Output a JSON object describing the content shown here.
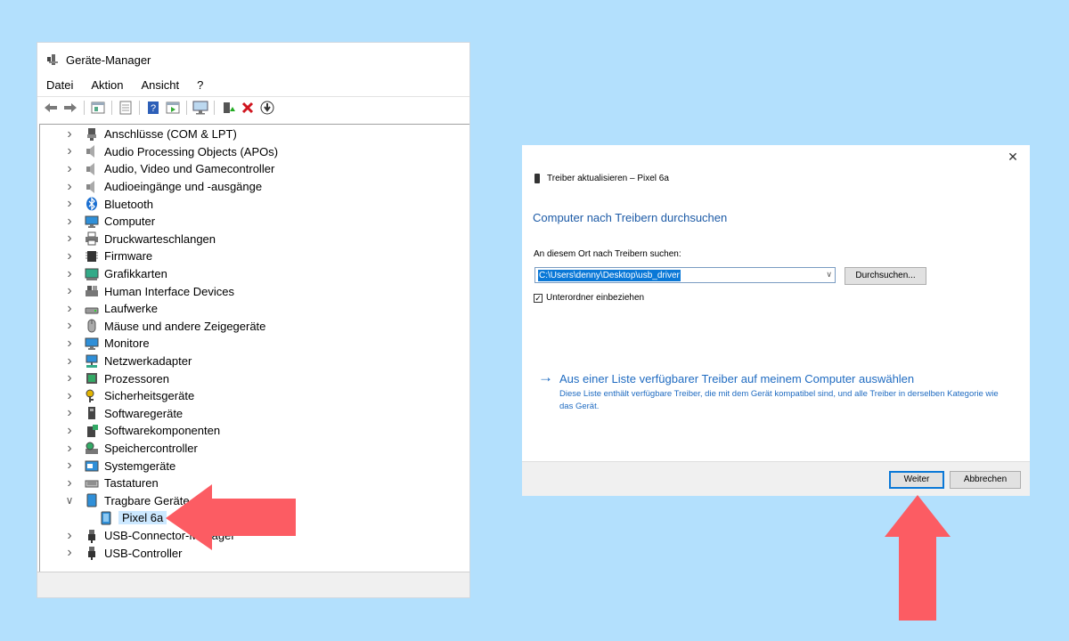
{
  "device_manager": {
    "title": "Geräte-Manager",
    "menu": [
      "Datei",
      "Aktion",
      "Ansicht",
      "?"
    ],
    "tree": [
      {
        "label": "Anschlüsse (COM & LPT)",
        "icon": "port-icon",
        "expanded": false
      },
      {
        "label": "Audio Processing Objects (APOs)",
        "icon": "speaker-icon",
        "expanded": false
      },
      {
        "label": "Audio, Video und Gamecontroller",
        "icon": "speaker-icon",
        "expanded": false
      },
      {
        "label": "Audioeingänge und -ausgänge",
        "icon": "speaker-icon",
        "expanded": false
      },
      {
        "label": "Bluetooth",
        "icon": "bluetooth-icon",
        "expanded": false
      },
      {
        "label": "Computer",
        "icon": "monitor-icon",
        "expanded": false
      },
      {
        "label": "Druckwarteschlangen",
        "icon": "printer-icon",
        "expanded": false
      },
      {
        "label": "Firmware",
        "icon": "chip-icon",
        "expanded": false
      },
      {
        "label": "Grafikkarten",
        "icon": "display-adapter-icon",
        "expanded": false
      },
      {
        "label": "Human Interface Devices",
        "icon": "hid-icon",
        "expanded": false
      },
      {
        "label": "Laufwerke",
        "icon": "drive-icon",
        "expanded": false
      },
      {
        "label": "Mäuse und andere Zeigegeräte",
        "icon": "mouse-icon",
        "expanded": false
      },
      {
        "label": "Monitore",
        "icon": "monitor-icon",
        "expanded": false
      },
      {
        "label": "Netzwerkadapter",
        "icon": "network-icon",
        "expanded": false
      },
      {
        "label": "Prozessoren",
        "icon": "processor-icon",
        "expanded": false
      },
      {
        "label": "Sicherheitsgeräte",
        "icon": "key-icon",
        "expanded": false
      },
      {
        "label": "Softwaregeräte",
        "icon": "software-device-icon",
        "expanded": false
      },
      {
        "label": "Softwarekomponenten",
        "icon": "software-component-icon",
        "expanded": false
      },
      {
        "label": "Speichercontroller",
        "icon": "storage-controller-icon",
        "expanded": false
      },
      {
        "label": "Systemgeräte",
        "icon": "system-folder-icon",
        "expanded": false
      },
      {
        "label": "Tastaturen",
        "icon": "keyboard-icon",
        "expanded": false
      },
      {
        "label": "Tragbare Geräte",
        "icon": "portable-device-icon",
        "expanded": true
      },
      {
        "label": "Pixel 6a",
        "icon": "phone-icon",
        "child": true,
        "selected": true
      },
      {
        "label": "USB-Connector-Manager",
        "icon": "usb-icon",
        "expanded": false
      },
      {
        "label": "USB-Controller",
        "icon": "usb-icon",
        "expanded": false
      }
    ]
  },
  "dialog": {
    "close": "✕",
    "header": "Treiber aktualisieren – Pixel 6a",
    "heading": "Computer nach Treibern durchsuchen",
    "location_label": "An diesem Ort nach Treibern suchen:",
    "path_value": "C:\\Users\\denny\\Desktop\\usb_driver",
    "browse": "Durchsuchen...",
    "include_subfolders": "Unterordner einbeziehen",
    "include_subfolders_checked": true,
    "link_title": "Aus einer Liste verfügbarer Treiber auf meinem Computer auswählen",
    "link_desc": "Diese Liste enthält verfügbare Treiber, die mit dem Gerät kompatibel sind, und alle Treiber in derselben Kategorie wie das Gerät.",
    "next": "Weiter",
    "cancel": "Abbrechen"
  },
  "colors": {
    "background": "#b3e0fd",
    "link": "#1f6bc1",
    "heading": "#1c5aa6",
    "selection": "#cce8ff",
    "arrow": "#fc5c63"
  }
}
